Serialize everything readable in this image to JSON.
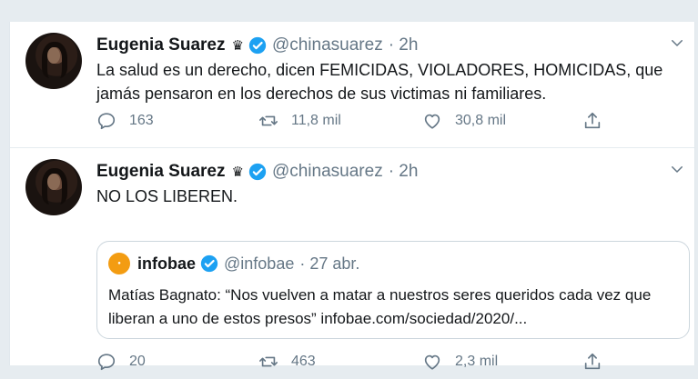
{
  "colors": {
    "accent": "#1da1f2",
    "muted": "#657786",
    "text": "#14171a"
  },
  "tweets": [
    {
      "author_name": "Eugenia Suarez",
      "author_badge_icon": "crown-icon",
      "handle": "@chinasuarez",
      "time": "· 2h",
      "text": "La salud es un derecho, dicen FEMICIDAS, VIOLADORES, HOMICIDAS, que jamás pensaron en los derechos de sus victimas ni familiares.",
      "replies": "163",
      "retweets": "11,8 mil",
      "likes": "30,8 mil"
    },
    {
      "author_name": "Eugenia Suarez",
      "author_badge_icon": "crown-icon",
      "handle": "@chinasuarez",
      "time": "· 2h",
      "text": "NO LOS LIBEREN.",
      "quote": {
        "name": "infobae",
        "handle": "@infobae",
        "time": "· 27 abr.",
        "text": "Matías Bagnato: “Nos vuelven a matar a nuestros seres queridos cada vez que liberan a uno de estos presos” infobae.com/sociedad/2020/..."
      },
      "replies": "20",
      "retweets": "463",
      "likes": "2,3 mil"
    }
  ]
}
